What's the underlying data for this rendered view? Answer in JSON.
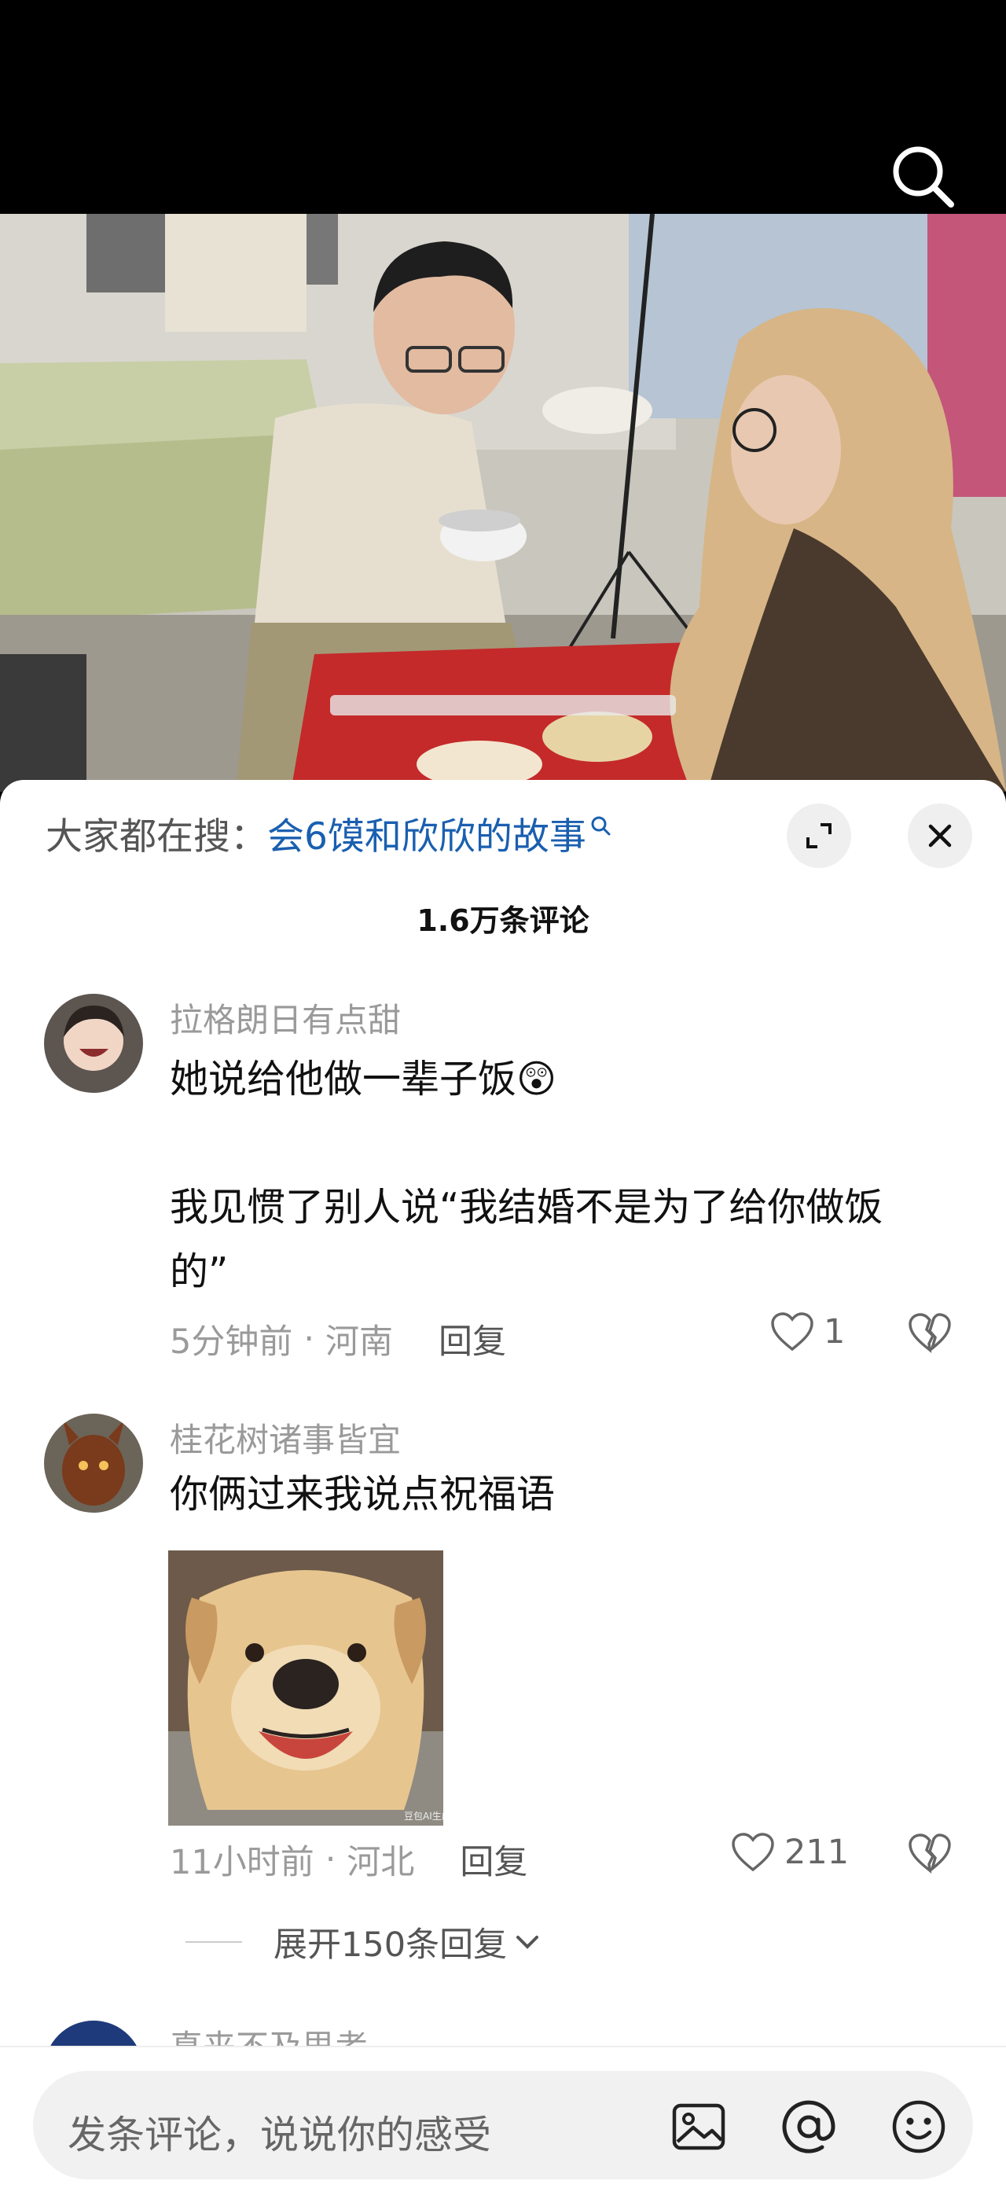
{
  "header": {
    "search_icon": "search-icon"
  },
  "sheet": {
    "search_prefix": "大家都在搜：",
    "search_query": "会6馍和欣欣的故事",
    "expand_icon": "expand-icon",
    "close_icon": "close-icon",
    "comment_count": "1.6万条评论"
  },
  "comments": [
    {
      "username": "拉格朗日有点甜",
      "line1": "她说给他做一辈子饭",
      "line1_emoji": "😲",
      "line2": "我见惯了别人说“我结婚不是为了给你做饭",
      "line3": "的”",
      "time": "5分钟前",
      "location": "河南",
      "reply": "回复",
      "likes": "1"
    },
    {
      "username": "桂花树诸事皆宜",
      "line1": "你俩过来我说点祝福语",
      "image_watermark": "豆包AI生成",
      "time": "11小时前",
      "location": "河北",
      "reply": "回复",
      "likes": "211",
      "expand_replies": "展开150条回复"
    },
    {
      "username": "真来不及思考"
    }
  ],
  "bottom": {
    "placeholder": "发条评论，说说你的感受",
    "image_icon": "image-icon",
    "mention_icon": "at-icon",
    "emoji_icon": "smile-icon"
  },
  "colors": {
    "link": "#1a5fb0",
    "muted": "#9a9a9a"
  }
}
